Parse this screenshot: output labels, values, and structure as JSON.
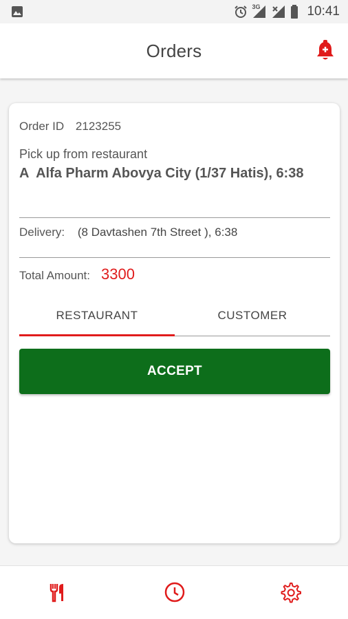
{
  "status_bar": {
    "time": "10:41",
    "network_label": "3G",
    "icons": [
      "image-icon",
      "alarm-icon",
      "signal-icon",
      "signal-x-icon",
      "battery-icon"
    ]
  },
  "app_bar": {
    "title": "Orders",
    "bell_icon": "notification-bell-icon"
  },
  "order": {
    "order_id_label": "Order ID",
    "order_id": "2123255",
    "pickup_label": "Pick up from restaurant",
    "pickup_name": "A  Alfa Pharm Abovya City (1/37 Hatis), 6:38",
    "delivery_label": "Delivery:",
    "delivery_value": "(8 Davtashen 7th Street ), 6:38",
    "total_label": "Total Amount:",
    "total_value": "3300"
  },
  "tabs": [
    {
      "label": "RESTAURANT",
      "active": true
    },
    {
      "label": "CUSTOMER",
      "active": false
    }
  ],
  "accept_label": "ACCEPT",
  "bottom_nav": {
    "items": [
      "fork-knife-icon",
      "clock-icon",
      "gear-icon"
    ]
  },
  "colors": {
    "accent_red": "#e01b1b",
    "accept_green": "#0d6e1b"
  }
}
